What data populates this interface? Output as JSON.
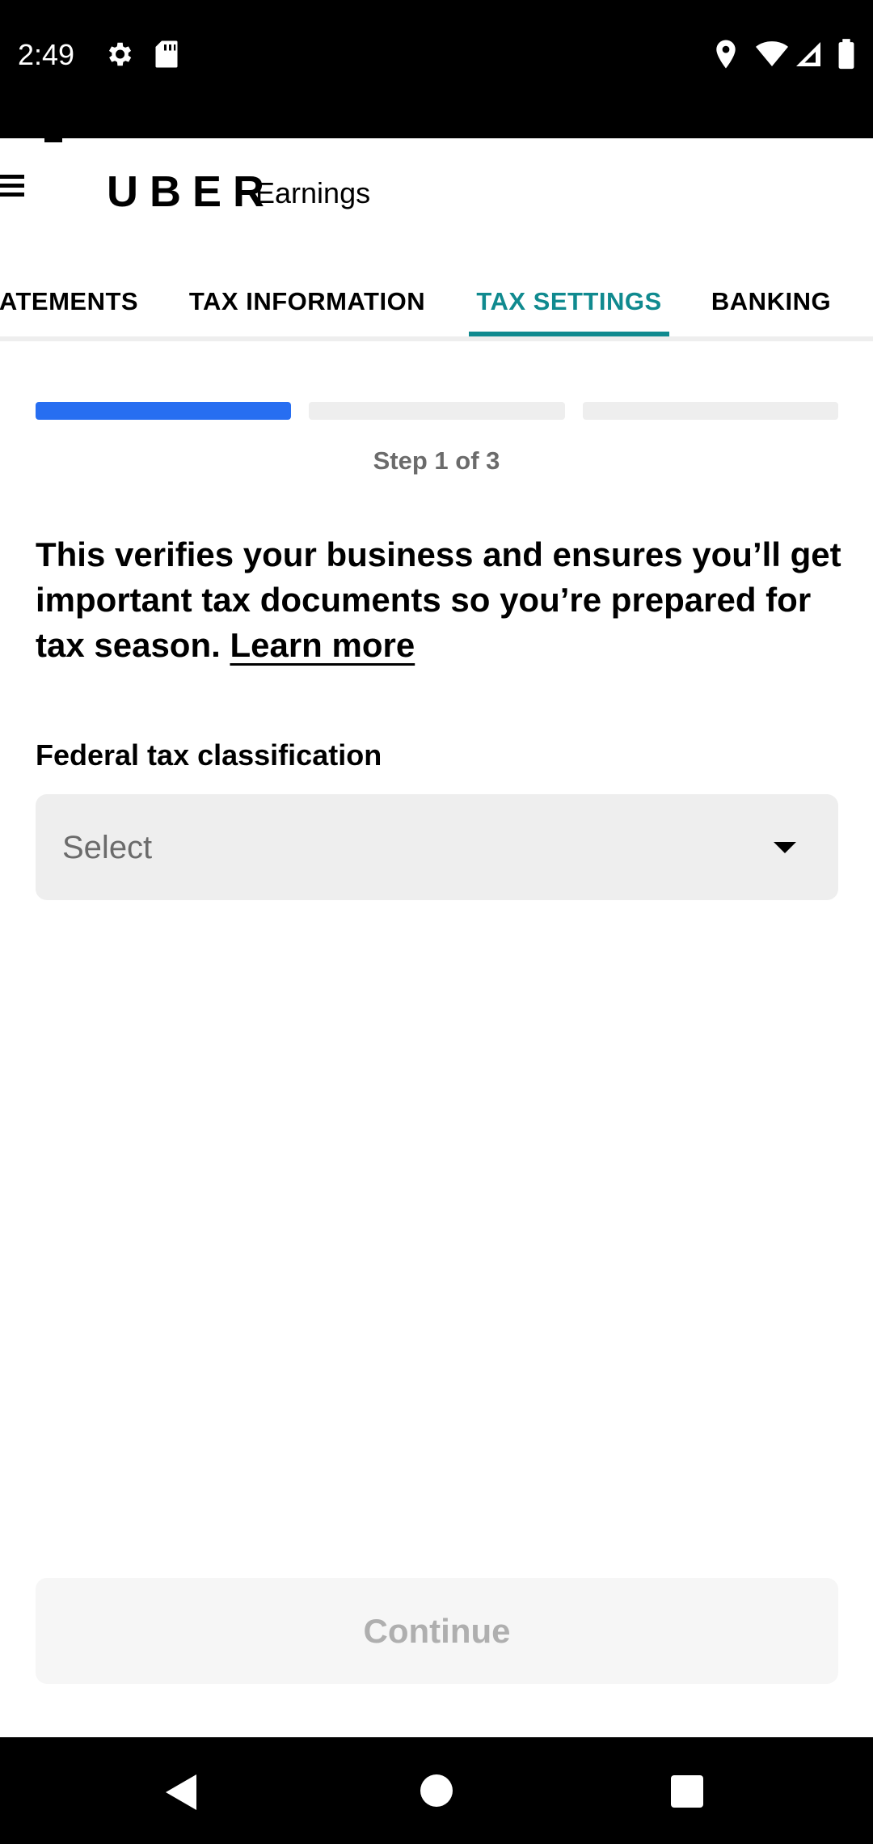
{
  "status_bar": {
    "time": "2:49",
    "icons": [
      "settings-icon",
      "sd-card-icon",
      "location-icon",
      "wifi-icon",
      "signal-icon",
      "battery-icon"
    ]
  },
  "header": {
    "brand": "UBER",
    "product": "Earnings"
  },
  "tabs": [
    {
      "label": "ATEMENTS"
    },
    {
      "label": "TAX INFORMATION"
    },
    {
      "label": "TAX SETTINGS",
      "active": true
    },
    {
      "label": "BANKING"
    }
  ],
  "progress": {
    "current_step": 1,
    "total_steps": 3,
    "label": "Step 1 of 3"
  },
  "description": {
    "text": "This verifies your business and ensures you’ll get important tax documents so you’re prepared for tax season. ",
    "link": "Learn more"
  },
  "form": {
    "label": "Federal tax classification",
    "select_value": "Select"
  },
  "continue_label": "Continue",
  "colors": {
    "accent": "#108a8f",
    "progress_active": "#276ef1",
    "progress_inactive": "#eeeeee",
    "disabled_text": "#afafaf"
  }
}
